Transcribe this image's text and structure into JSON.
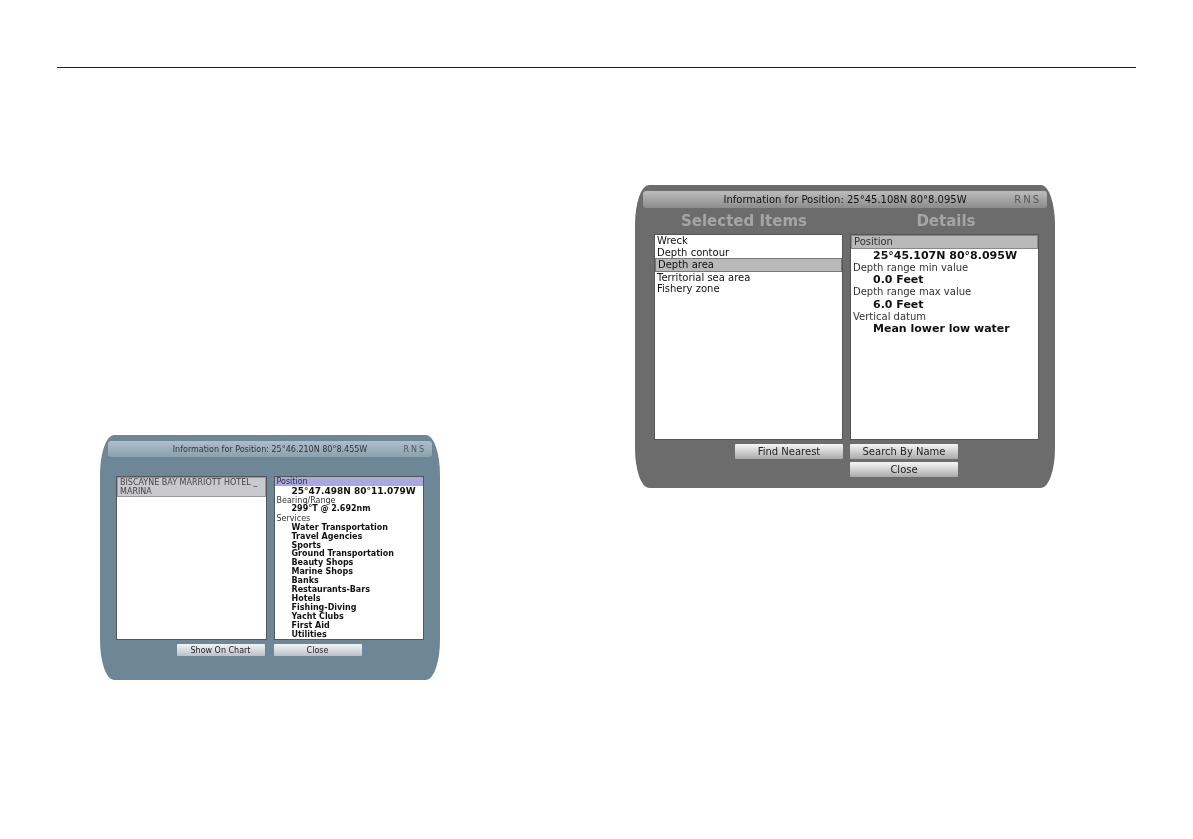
{
  "dialogs": [
    {
      "title": "Information for Position: 25°46.210N 80°8.455W",
      "brand": "RNS",
      "items": [
        {
          "text": "BISCAYNE BAY MARRIOTT HOTEL _ MARINA",
          "selected": true
        }
      ],
      "details": [
        {
          "kind": "label",
          "text": "Position",
          "selected": true
        },
        {
          "kind": "value",
          "text": "25°47.498N 80°11.079W"
        },
        {
          "kind": "label",
          "text": "Bearing/Range",
          "selected": false
        },
        {
          "kind": "value",
          "text": "299°T @ 2.692nm"
        },
        {
          "kind": "label",
          "text": "Services",
          "selected": false
        },
        {
          "kind": "value",
          "text": "Water Transportation"
        },
        {
          "kind": "value",
          "text": "Travel Agencies"
        },
        {
          "kind": "value",
          "text": "Sports"
        },
        {
          "kind": "value",
          "text": "Ground Transportation"
        },
        {
          "kind": "value",
          "text": "Beauty Shops"
        },
        {
          "kind": "value",
          "text": "Marine Shops"
        },
        {
          "kind": "value",
          "text": "Banks"
        },
        {
          "kind": "value",
          "text": "Restaurants-Bars"
        },
        {
          "kind": "value",
          "text": "Hotels"
        },
        {
          "kind": "value",
          "text": "Fishing-Diving"
        },
        {
          "kind": "value",
          "text": "Yacht Clubs"
        },
        {
          "kind": "value",
          "text": "First Aid"
        },
        {
          "kind": "value",
          "text": "Utilities"
        }
      ],
      "left_buttons": [
        "Show On Chart"
      ],
      "right_buttons": [
        "Close"
      ]
    },
    {
      "title": "Information for Position: 25°45.108N 80°8.095W",
      "brand": "RNS",
      "headings": [
        "Selected Items",
        "Details"
      ],
      "items": [
        {
          "text": "Wreck",
          "selected": false
        },
        {
          "text": "Depth contour",
          "selected": false
        },
        {
          "text": "Depth area",
          "selected": true
        },
        {
          "text": "Territorial sea area",
          "selected": false
        },
        {
          "text": "Fishery zone",
          "selected": false
        }
      ],
      "details": [
        {
          "kind": "label",
          "text": "Position",
          "selected": true
        },
        {
          "kind": "value",
          "text": "25°45.107N 80°8.095W"
        },
        {
          "kind": "label",
          "text": "Depth range min value",
          "selected": false
        },
        {
          "kind": "value",
          "text": "0.0 Feet"
        },
        {
          "kind": "label",
          "text": "Depth range max value",
          "selected": false
        },
        {
          "kind": "value",
          "text": "6.0 Feet"
        },
        {
          "kind": "label",
          "text": "Vertical datum",
          "selected": false
        },
        {
          "kind": "value",
          "text": "Mean lower low water"
        }
      ],
      "left_buttons": [
        "Find Nearest"
      ],
      "right_buttons": [
        "Search By Name",
        "Close"
      ]
    }
  ]
}
